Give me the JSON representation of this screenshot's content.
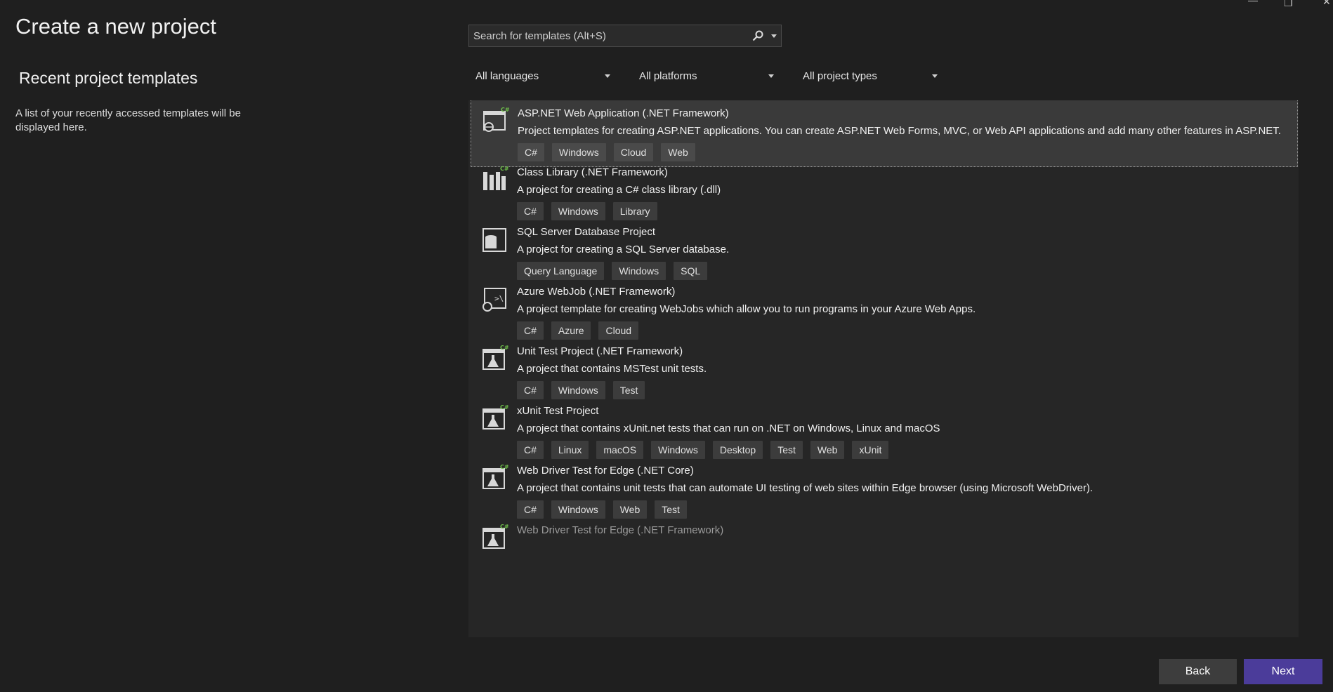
{
  "header": {
    "title": "Create a new project"
  },
  "recent": {
    "title": "Recent project templates",
    "description": "A list of your recently accessed templates will be displayed here."
  },
  "search": {
    "placeholder": "Search for templates (Alt+S)"
  },
  "filters": {
    "language": "All languages",
    "platform": "All platforms",
    "project_type": "All project types"
  },
  "templates": [
    {
      "name": "ASP.NET Web Application (.NET Framework)",
      "description": "Project templates for creating ASP.NET applications. You can create ASP.NET Web Forms, MVC, or Web API applications and add many other features in ASP.NET.",
      "tags": [
        "C#",
        "Windows",
        "Cloud",
        "Web"
      ],
      "icon": "aspnet-web-icon",
      "selected": true
    },
    {
      "name": "Class Library (.NET Framework)",
      "description": "A project for creating a C# class library (.dll)",
      "tags": [
        "C#",
        "Windows",
        "Library"
      ],
      "icon": "class-library-icon"
    },
    {
      "name": "SQL Server Database Project",
      "description": "A project for creating a SQL Server database.",
      "tags": [
        "Query Language",
        "Windows",
        "SQL"
      ],
      "icon": "database-icon"
    },
    {
      "name": "Azure WebJob (.NET Framework)",
      "description": "A project template for creating WebJobs which allow you to run programs in your Azure Web Apps.",
      "tags": [
        "C#",
        "Azure",
        "Cloud"
      ],
      "icon": "azure-webjob-icon"
    },
    {
      "name": "Unit Test Project (.NET Framework)",
      "description": "A project that contains MSTest unit tests.",
      "tags": [
        "C#",
        "Windows",
        "Test"
      ],
      "icon": "flask-test-icon"
    },
    {
      "name": "xUnit Test Project",
      "description": "A project that contains xUnit.net tests that can run on .NET on Windows, Linux and macOS",
      "tags": [
        "C#",
        "Linux",
        "macOS",
        "Windows",
        "Desktop",
        "Test",
        "Web",
        "xUnit"
      ],
      "icon": "flask-test-icon"
    },
    {
      "name": "Web Driver Test for Edge (.NET Core)",
      "description": "A project that contains unit tests that can automate UI testing of web sites within Edge browser (using Microsoft WebDriver).",
      "tags": [
        "C#",
        "Windows",
        "Web",
        "Test"
      ],
      "icon": "flask-test-icon"
    },
    {
      "name": "Web Driver Test for Edge (.NET Framework)",
      "description": "",
      "tags": [],
      "icon": "flask-test-icon"
    }
  ],
  "buttons": {
    "back": "Back",
    "next": "Next"
  },
  "colors": {
    "background": "#1f1f1f",
    "list_bg": "#262626",
    "selected_bg": "#3a3a3a",
    "accent": "#4b3c9a",
    "csharp_badge": "#6fbf4a"
  }
}
